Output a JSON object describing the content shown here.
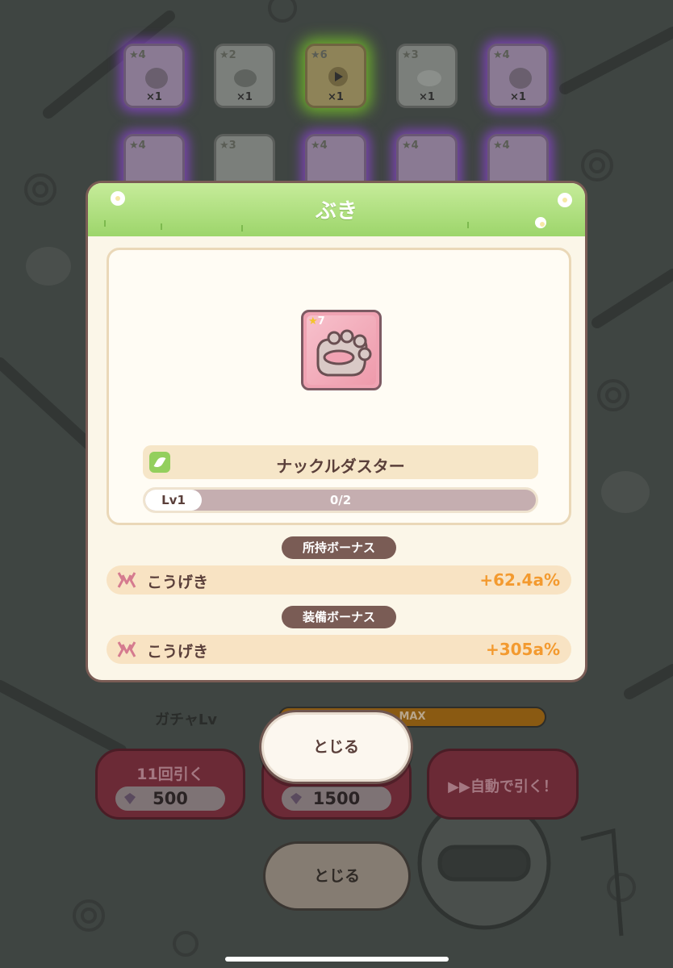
{
  "background_grid": {
    "row1": [
      {
        "stars": "4",
        "count": "×1",
        "glow": "purple"
      },
      {
        "stars": "2",
        "count": "×1",
        "glow": "none"
      },
      {
        "stars": "6",
        "count": "×1",
        "glow": "green"
      },
      {
        "stars": "3",
        "count": "×1",
        "glow": "none"
      },
      {
        "stars": "4",
        "count": "×1",
        "glow": "purple"
      }
    ],
    "row2": [
      {
        "stars": "4",
        "glow": "purple"
      },
      {
        "stars": "3",
        "glow": "none"
      },
      {
        "stars": "4",
        "glow": "purple"
      },
      {
        "stars": "4",
        "glow": "purple"
      },
      {
        "stars": "4",
        "glow": "purple"
      }
    ]
  },
  "gacha": {
    "level_label": "ガチャLv",
    "level_value": "MAX",
    "pull_11": {
      "label": "11回引く",
      "cost": "500"
    },
    "pull_big": {
      "cost": "1500"
    },
    "auto_pull": {
      "label": "▶▶自動で引く！"
    },
    "close_label": "とじる"
  },
  "dialog": {
    "title": "ぶき",
    "item": {
      "stars": "7",
      "name": "ナックルダスター",
      "level": "Lv1",
      "progress": "0/2",
      "progress_fraction": 0
    },
    "owned_bonus": {
      "heading": "所持ボーナス",
      "stat": "こうげき",
      "value": "+62.4a%"
    },
    "equip_bonus": {
      "heading": "装備ボーナス",
      "stat": "こうげき",
      "value": "+305a%"
    },
    "close_label": "とじる"
  },
  "colors": {
    "header_green": "#9dd56b",
    "accent_orange": "#f39a2f",
    "text_brown": "#5a3f3a",
    "overlay_bg": "#3f4542"
  }
}
